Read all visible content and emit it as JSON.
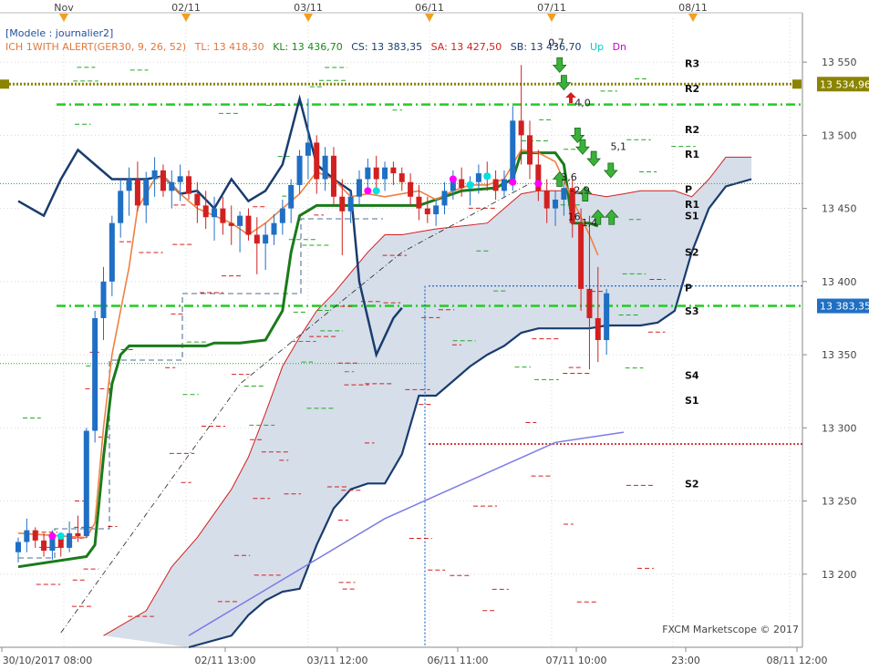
{
  "chart_data": {
    "type": "candlestick",
    "instrument": "GER30",
    "template": "[Modele : journalier2]",
    "indicator": {
      "name": "ICH 1WITH ALERT(GER30, 9, 26, 52)",
      "tl": "TL: 13 418,30",
      "kl": "KL: 13 436,70",
      "cs": "CS: 13 383,35",
      "sa": "SA: 13 427,50",
      "sb": "SB: 13 436,70",
      "up": "Up",
      "dn": "Dn"
    },
    "ylim": [
      13150,
      13580
    ],
    "y_ticks": [
      {
        "v": 13200,
        "label": "13 200"
      },
      {
        "v": 13250,
        "label": "13 250"
      },
      {
        "v": 13300,
        "label": "13 300"
      },
      {
        "v": 13350,
        "label": "13 350"
      },
      {
        "v": 13400,
        "label": "13 400"
      },
      {
        "v": 13450,
        "label": "13 450"
      },
      {
        "v": 13500,
        "label": "13 500"
      },
      {
        "v": 13550,
        "label": "13 550"
      }
    ],
    "top_date_labels": [
      "Nov",
      "02/11",
      "03/11",
      "06/11",
      "07/11",
      "08/11"
    ],
    "bottom_date_labels": [
      "30/10/2017 08:00",
      "02/11 13:00",
      "03/11 12:00",
      "06/11 11:00",
      "07/11 10:00",
      "23:00",
      "08/11 12:00"
    ],
    "price_tags": [
      {
        "label": "13 534,96",
        "v": 13534.96,
        "color": "#8a8400"
      },
      {
        "label": "13 383,35",
        "v": 13383.35,
        "color": "#1f6fc4"
      }
    ],
    "pivot_labels": [
      {
        "label": "R3",
        "v": 13549
      },
      {
        "label": "R2",
        "v": 13532
      },
      {
        "label": "R2",
        "v": 13504
      },
      {
        "label": "R1",
        "v": 13487
      },
      {
        "label": "P",
        "v": 13463
      },
      {
        "label": "R1",
        "v": 13453
      },
      {
        "label": "S1",
        "v": 13445
      },
      {
        "label": "S2",
        "v": 13420
      },
      {
        "label": "P",
        "v": 13396
      },
      {
        "label": "S3",
        "v": 13380
      },
      {
        "label": "S4",
        "v": 13336
      },
      {
        "label": "S1",
        "v": 13319
      },
      {
        "label": "S2",
        "v": 13262
      }
    ],
    "signal_labels": [
      {
        "label": "0,7",
        "v": 13561
      },
      {
        "label": "4,0",
        "v": 13520
      },
      {
        "label": "5,1",
        "v": 13490
      },
      {
        "label": "3,6",
        "v": 13469
      },
      {
        "label": "-2,9",
        "v": 13460
      },
      {
        "label": "16",
        "v": 13442
      },
      {
        "label": "1,4",
        "v": 13438
      }
    ],
    "horizontal_levels": [
      {
        "name": "alert-olive",
        "v": 13534.96,
        "color": "#8a8400"
      },
      {
        "name": "green-dashdot-upper",
        "v": 13521,
        "color": "#22cc22"
      },
      {
        "name": "green-dashdot-lower",
        "v": 13383.35,
        "color": "#22cc22"
      },
      {
        "name": "green-dotted-1",
        "v": 13467,
        "color": "#22aa22"
      },
      {
        "name": "green-dotted-2",
        "v": 13344,
        "color": "#22aa22"
      },
      {
        "name": "blue-dotted",
        "v": 13397,
        "color": "#1f6fc4"
      },
      {
        "name": "red-dotted",
        "v": 13289,
        "color": "#cc0000"
      }
    ],
    "candles": [
      [
        13215,
        13225,
        13208,
        13222
      ],
      [
        13222,
        13238,
        13215,
        13230
      ],
      [
        13230,
        13232,
        13218,
        13223
      ],
      [
        13223,
        13228,
        13212,
        13216
      ],
      [
        13216,
        13230,
        13210,
        13226
      ],
      [
        13226,
        13228,
        13212,
        13218
      ],
      [
        13218,
        13236,
        13215,
        13228
      ],
      [
        13228,
        13240,
        13222,
        13226
      ],
      [
        13226,
        13300,
        13225,
        13298
      ],
      [
        13298,
        13380,
        13290,
        13375
      ],
      [
        13375,
        13410,
        13360,
        13400
      ],
      [
        13400,
        13445,
        13390,
        13440
      ],
      [
        13440,
        13470,
        13430,
        13462
      ],
      [
        13462,
        13478,
        13445,
        13470
      ],
      [
        13470,
        13482,
        13448,
        13452
      ],
      [
        13452,
        13475,
        13440,
        13470
      ],
      [
        13470,
        13485,
        13458,
        13476
      ],
      [
        13476,
        13480,
        13458,
        13462
      ],
      [
        13462,
        13476,
        13450,
        13468
      ],
      [
        13468,
        13480,
        13455,
        13472
      ],
      [
        13472,
        13476,
        13456,
        13460
      ],
      [
        13460,
        13468,
        13440,
        13452
      ],
      [
        13452,
        13462,
        13436,
        13444
      ],
      [
        13444,
        13458,
        13428,
        13450
      ],
      [
        13450,
        13458,
        13432,
        13440
      ],
      [
        13440,
        13452,
        13425,
        13438
      ],
      [
        13438,
        13448,
        13420,
        13445
      ],
      [
        13445,
        13450,
        13428,
        13432
      ],
      [
        13432,
        13444,
        13405,
        13426
      ],
      [
        13426,
        13440,
        13408,
        13432
      ],
      [
        13432,
        13446,
        13425,
        13440
      ],
      [
        13440,
        13456,
        13432,
        13450
      ],
      [
        13450,
        13470,
        13440,
        13466
      ],
      [
        13466,
        13490,
        13460,
        13486
      ],
      [
        13486,
        13525,
        13470,
        13495
      ],
      [
        13495,
        13500,
        13460,
        13470
      ],
      [
        13470,
        13492,
        13462,
        13486
      ],
      [
        13486,
        13492,
        13452,
        13458
      ],
      [
        13458,
        13470,
        13418,
        13448
      ],
      [
        13448,
        13462,
        13440,
        13458
      ],
      [
        13458,
        13476,
        13452,
        13470
      ],
      [
        13470,
        13484,
        13462,
        13478
      ],
      [
        13478,
        13486,
        13464,
        13470
      ],
      [
        13470,
        13482,
        13462,
        13478
      ],
      [
        13478,
        13482,
        13466,
        13474
      ],
      [
        13474,
        13478,
        13462,
        13468
      ],
      [
        13468,
        13474,
        13452,
        13458
      ],
      [
        13458,
        13466,
        13442,
        13450
      ],
      [
        13450,
        13458,
        13440,
        13446
      ],
      [
        13446,
        13456,
        13438,
        13452
      ],
      [
        13452,
        13468,
        13446,
        13462
      ],
      [
        13462,
        13476,
        13456,
        13470
      ],
      [
        13470,
        13478,
        13458,
        13464
      ],
      [
        13464,
        13472,
        13452,
        13468
      ],
      [
        13468,
        13480,
        13460,
        13474
      ],
      [
        13474,
        13482,
        13462,
        13470
      ],
      [
        13470,
        13476,
        13456,
        13462
      ],
      [
        13462,
        13476,
        13458,
        13470
      ],
      [
        13470,
        13520,
        13462,
        13510
      ],
      [
        13510,
        13548,
        13480,
        13500
      ],
      [
        13500,
        13510,
        13470,
        13480
      ],
      [
        13480,
        13490,
        13455,
        13462
      ],
      [
        13462,
        13470,
        13440,
        13450
      ],
      [
        13450,
        13462,
        13438,
        13456
      ],
      [
        13456,
        13468,
        13445,
        13464
      ],
      [
        13464,
        13470,
        13430,
        13440
      ],
      [
        13440,
        13450,
        13380,
        13395
      ],
      [
        13395,
        13445,
        13340,
        13375
      ],
      [
        13375,
        13410,
        13345,
        13360
      ],
      [
        13360,
        13395,
        13350,
        13392
      ]
    ],
    "kijun": [
      [
        0,
        13205
      ],
      [
        8,
        13212
      ],
      [
        9,
        13220
      ],
      [
        10,
        13280
      ],
      [
        11,
        13330
      ],
      [
        12,
        13350
      ],
      [
        13,
        13356
      ],
      [
        16,
        13356
      ],
      [
        22,
        13356
      ],
      [
        23,
        13358
      ],
      [
        26,
        13358
      ],
      [
        29,
        13360
      ],
      [
        31,
        13380
      ],
      [
        32,
        13420
      ],
      [
        33,
        13445
      ],
      [
        35,
        13452
      ],
      [
        40,
        13452
      ],
      [
        47,
        13452
      ],
      [
        52,
        13462
      ],
      [
        56,
        13464
      ],
      [
        58,
        13470
      ],
      [
        59,
        13488
      ],
      [
        63,
        13488
      ],
      [
        64,
        13480
      ],
      [
        65,
        13440
      ],
      [
        67,
        13440
      ],
      [
        68,
        13438
      ]
    ],
    "tenkan": [
      [
        0,
        13228
      ],
      [
        8,
        13225
      ],
      [
        9,
        13235
      ],
      [
        10,
        13300
      ],
      [
        11,
        13350
      ],
      [
        12,
        13380
      ],
      [
        13,
        13410
      ],
      [
        14,
        13450
      ],
      [
        16,
        13470
      ],
      [
        17,
        13472
      ],
      [
        19,
        13460
      ],
      [
        21,
        13450
      ],
      [
        23,
        13445
      ],
      [
        25,
        13440
      ],
      [
        27,
        13432
      ],
      [
        29,
        13440
      ],
      [
        31,
        13450
      ],
      [
        33,
        13460
      ],
      [
        35,
        13475
      ],
      [
        37,
        13470
      ],
      [
        39,
        13458
      ],
      [
        41,
        13460
      ],
      [
        43,
        13458
      ],
      [
        45,
        13460
      ],
      [
        47,
        13462
      ],
      [
        49,
        13456
      ],
      [
        51,
        13462
      ],
      [
        53,
        13466
      ],
      [
        55,
        13466
      ],
      [
        57,
        13470
      ],
      [
        59,
        13490
      ],
      [
        61,
        13488
      ],
      [
        63,
        13482
      ],
      [
        65,
        13456
      ],
      [
        67,
        13432
      ],
      [
        68,
        13418
      ]
    ],
    "chikou": [
      [
        0,
        13455
      ],
      [
        3,
        13445
      ],
      [
        5,
        13470
      ],
      [
        7,
        13490
      ],
      [
        9,
        13480
      ],
      [
        11,
        13470
      ],
      [
        13,
        13470
      ],
      [
        15,
        13470
      ],
      [
        17,
        13472
      ],
      [
        19,
        13460
      ],
      [
        21,
        13462
      ],
      [
        23,
        13450
      ],
      [
        25,
        13470
      ],
      [
        27,
        13455
      ],
      [
        29,
        13462
      ],
      [
        31,
        13480
      ],
      [
        33,
        13525
      ],
      [
        35,
        13480
      ],
      [
        37,
        13470
      ],
      [
        39,
        13462
      ],
      [
        40,
        13400
      ],
      [
        42,
        13350
      ],
      [
        44,
        13375
      ],
      [
        45,
        13382
      ]
    ],
    "senkou_a": [
      [
        10,
        13158
      ],
      [
        15,
        13175
      ],
      [
        18,
        13205
      ],
      [
        21,
        13225
      ],
      [
        25,
        13258
      ],
      [
        27,
        13280
      ],
      [
        29,
        13310
      ],
      [
        31,
        13342
      ],
      [
        33,
        13362
      ],
      [
        35,
        13380
      ],
      [
        37,
        13392
      ],
      [
        39,
        13406
      ],
      [
        41,
        13420
      ],
      [
        43,
        13432
      ],
      [
        45,
        13432
      ],
      [
        47,
        13434
      ],
      [
        49,
        13436
      ],
      [
        52,
        13438
      ],
      [
        55,
        13440
      ],
      [
        57,
        13450
      ],
      [
        59,
        13460
      ],
      [
        61,
        13462
      ],
      [
        63,
        13462
      ],
      [
        65,
        13462
      ],
      [
        67,
        13460
      ],
      [
        69,
        13458
      ],
      [
        71,
        13460
      ],
      [
        73,
        13462
      ],
      [
        75,
        13462
      ],
      [
        77,
        13462
      ],
      [
        79,
        13458
      ],
      [
        81,
        13470
      ],
      [
        83,
        13485
      ],
      [
        86,
        13485
      ]
    ],
    "senkou_b": [
      [
        20,
        13150
      ],
      [
        25,
        13158
      ],
      [
        27,
        13172
      ],
      [
        29,
        13182
      ],
      [
        31,
        13188
      ],
      [
        33,
        13190
      ],
      [
        35,
        13220
      ],
      [
        37,
        13245
      ],
      [
        39,
        13258
      ],
      [
        41,
        13262
      ],
      [
        43,
        13262
      ],
      [
        45,
        13282
      ],
      [
        47,
        13322
      ],
      [
        49,
        13322
      ],
      [
        51,
        13332
      ],
      [
        53,
        13342
      ],
      [
        55,
        13350
      ],
      [
        57,
        13356
      ],
      [
        59,
        13365
      ],
      [
        61,
        13368
      ],
      [
        63,
        13368
      ],
      [
        65,
        13368
      ],
      [
        67,
        13368
      ],
      [
        69,
        13370
      ],
      [
        71,
        13370
      ],
      [
        73,
        13370
      ],
      [
        75,
        13372
      ],
      [
        77,
        13380
      ],
      [
        79,
        13420
      ],
      [
        81,
        13450
      ],
      [
        83,
        13465
      ],
      [
        86,
        13470
      ]
    ],
    "trend_line": [
      [
        20,
        13158
      ],
      [
        43,
        13238
      ],
      [
        63,
        13290
      ],
      [
        71,
        13297
      ]
    ],
    "black_dash_line": [
      [
        5,
        13160
      ],
      [
        26,
        13330
      ],
      [
        45,
        13420
      ],
      [
        60,
        13467
      ]
    ],
    "ui": {
      "watermark": "FXCM Marketscope © 2017"
    }
  }
}
